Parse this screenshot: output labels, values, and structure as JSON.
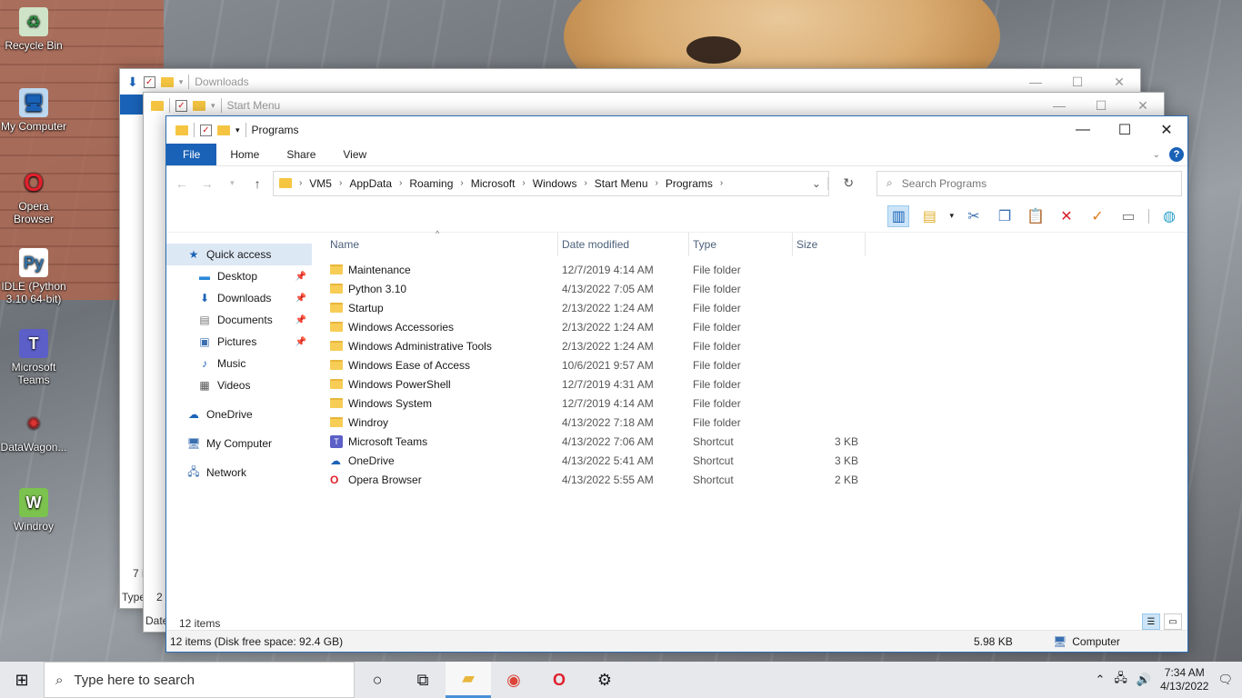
{
  "desktop": {
    "icons": [
      {
        "label": "Recycle Bin",
        "icon": "recycle-bin-icon"
      },
      {
        "label": "My Computer",
        "icon": "computer-icon"
      },
      {
        "label": "Opera Browser",
        "icon": "opera-icon"
      },
      {
        "label": "IDLE (Python 3.10 64-bit)",
        "icon": "python-icon"
      },
      {
        "label": "Microsoft Teams",
        "icon": "teams-icon"
      },
      {
        "label": "DataWagon...",
        "icon": "datawagon-icon"
      },
      {
        "label": "Windroy",
        "icon": "windroy-icon"
      }
    ]
  },
  "bg_windows": {
    "downloads_title": "Downloads",
    "startmenu_title": "Start Menu",
    "downloads_partial_count": "7 i",
    "downloads_partial_col": "Type",
    "startmenu_partial_count": "2 i",
    "startmenu_partial_col": "Date"
  },
  "window": {
    "title": "Programs",
    "controls": {
      "minimize": "—",
      "maximize": "☐",
      "close": "✕"
    },
    "ribbon_tabs": [
      "File",
      "Home",
      "Share",
      "View"
    ],
    "help": "?",
    "breadcrumb": [
      "VM5",
      "AppData",
      "Roaming",
      "Microsoft",
      "Windows",
      "Start Menu",
      "Programs"
    ],
    "search_placeholder": "Search Programs",
    "nav": {
      "quick_access": "Quick access",
      "desktop": "Desktop",
      "downloads": "Downloads",
      "documents": "Documents",
      "pictures": "Pictures",
      "music": "Music",
      "videos": "Videos",
      "onedrive": "OneDrive",
      "my_computer": "My Computer",
      "network": "Network"
    },
    "columns": {
      "name": "Name",
      "date": "Date modified",
      "type": "Type",
      "size": "Size"
    },
    "files": [
      {
        "name": "Maintenance",
        "date": "12/7/2019 4:14 AM",
        "type": "File folder",
        "size": "",
        "icon": "folder"
      },
      {
        "name": "Python 3.10",
        "date": "4/13/2022 7:05 AM",
        "type": "File folder",
        "size": "",
        "icon": "folder"
      },
      {
        "name": "Startup",
        "date": "2/13/2022 1:24 AM",
        "type": "File folder",
        "size": "",
        "icon": "folder"
      },
      {
        "name": "Windows Accessories",
        "date": "2/13/2022 1:24 AM",
        "type": "File folder",
        "size": "",
        "icon": "folder"
      },
      {
        "name": "Windows Administrative Tools",
        "date": "2/13/2022 1:24 AM",
        "type": "File folder",
        "size": "",
        "icon": "folder"
      },
      {
        "name": "Windows Ease of Access",
        "date": "10/6/2021 9:57 AM",
        "type": "File folder",
        "size": "",
        "icon": "folder"
      },
      {
        "name": "Windows PowerShell",
        "date": "12/7/2019 4:31 AM",
        "type": "File folder",
        "size": "",
        "icon": "folder"
      },
      {
        "name": "Windows System",
        "date": "12/7/2019 4:14 AM",
        "type": "File folder",
        "size": "",
        "icon": "folder"
      },
      {
        "name": "Windroy",
        "date": "4/13/2022 7:18 AM",
        "type": "File folder",
        "size": "",
        "icon": "folder"
      },
      {
        "name": "Microsoft Teams",
        "date": "4/13/2022 7:06 AM",
        "type": "Shortcut",
        "size": "3 KB",
        "icon": "teams"
      },
      {
        "name": "OneDrive",
        "date": "4/13/2022 5:41 AM",
        "type": "Shortcut",
        "size": "3 KB",
        "icon": "onedrive"
      },
      {
        "name": "Opera Browser",
        "date": "4/13/2022 5:55 AM",
        "type": "Shortcut",
        "size": "2 KB",
        "icon": "opera"
      }
    ],
    "item_count": "12 items",
    "status_left": "12 items (Disk free space: 92.4 GB)",
    "status_size": "5.98 KB",
    "status_location": "Computer"
  },
  "taskbar": {
    "search_placeholder": "Type here to search",
    "time": "7:34 AM",
    "date": "4/13/2022"
  },
  "colors": {
    "accent": "#1a62b7",
    "folder": "#f7cd55",
    "selection": "#dde8f5"
  }
}
